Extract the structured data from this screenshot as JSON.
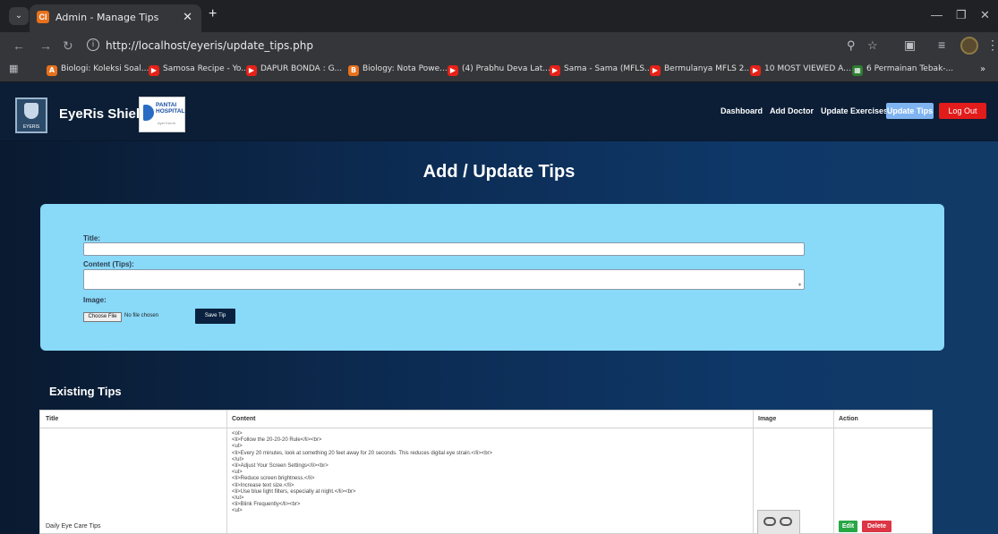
{
  "browser": {
    "tab_title": "Admin - Manage Tips",
    "tab_favicon": "CI",
    "url": "http://localhost/eyeris/update_tips.php",
    "bookmarks": [
      {
        "label": "Biologi: Koleksi Soal...",
        "icon": "A",
        "color": "#e8711c"
      },
      {
        "label": "Samosa Recipe - Yo...",
        "icon": "▶",
        "color": "#e62117"
      },
      {
        "label": "DAPUR BONDA : G...",
        "icon": "▶",
        "color": "#e62117"
      },
      {
        "label": "Biology: Nota Powe...",
        "icon": "B",
        "color": "#e8711c"
      },
      {
        "label": "(4) Prabhu Deva Lat...",
        "icon": "▶",
        "color": "#e62117"
      },
      {
        "label": "Sama - Sama (MFLS...",
        "icon": "▶",
        "color": "#e62117"
      },
      {
        "label": "Bermulanya MFLS 2...",
        "icon": "▶",
        "color": "#e62117"
      },
      {
        "label": "10 MOST VIEWED A...",
        "icon": "▶",
        "color": "#e62117"
      },
      {
        "label": "6 Permainan Tebak-...",
        "icon": "▦",
        "color": "#2e7d32"
      }
    ]
  },
  "navbar": {
    "brand": "EyeRis Shield",
    "eyeris_logo_text": "EYERIS",
    "pantai_logo_text": "PANTAI\nHOSPITAL",
    "pantai_logo_sub": "Ayer Keroh",
    "links": [
      "Dashboard",
      "Add Doctor",
      "Update Exercises"
    ],
    "active_link": "Update Tips",
    "logout": "Log Out"
  },
  "form": {
    "heading": "Add / Update Tips",
    "title_label": "Title:",
    "title_value": "",
    "content_label": "Content (Tips):",
    "content_value": "",
    "image_label": "Image:",
    "choose_file": "Choose File",
    "no_file": "No file chosen",
    "save_button": "Save Tip"
  },
  "existing": {
    "heading": "Existing Tips",
    "columns": [
      "Title",
      "Content",
      "Image",
      "Action"
    ],
    "rows": [
      {
        "title": "Daily Eye Care Tips",
        "content": "<ol>\n<li>Follow the 20-20-20 Rule</li><br>\n<ul>\n<li>Every 20 minutes, look at something 20 feet away for 20 seconds. This reduces digital eye strain.</li><br>\n</ul>\n<li>Adjust Your Screen Settings</li><br>\n<ul>\n<li>Reduce screen brightness.</li>\n<li>Increase text size.</li>\n<li>Use blue light filters, especially at night.</li><br>\n</ul>\n<li>Blink Frequently</li><br>\n<ul>",
        "edit": "Edit",
        "delete": "Delete"
      }
    ]
  }
}
